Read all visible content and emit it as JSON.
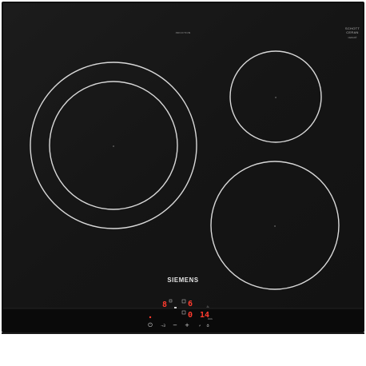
{
  "appliance": {
    "type": "induction-hob",
    "colors": {
      "glass": "#161616",
      "frame": "#0b0b0b",
      "ring": "#d9d9d9",
      "display": "#ff3b2e",
      "label": "#cfcfcf"
    }
  },
  "top_label": "INDUCTION",
  "brand_corner": {
    "line1": "SCHOTT",
    "line2": "CERAN",
    "line3": "CERAN®"
  },
  "brand_logo": "SIEMENS",
  "zones": [
    {
      "id": "left-large",
      "label": "⊃"
    },
    {
      "id": "top-right-small",
      "label": "⊃"
    },
    {
      "id": "bottom-right-medium",
      "label": "⊃"
    }
  ],
  "display": {
    "zone_power": "8",
    "timer_a": "6",
    "timer_b": "0",
    "minutes": "14",
    "min_unit": "min",
    "heat_icon": "♨"
  },
  "controls": {
    "power": "⏻",
    "key": "⊸3",
    "minus": "−",
    "plus": "+",
    "boost": "⚡",
    "timer": "⏱"
  }
}
